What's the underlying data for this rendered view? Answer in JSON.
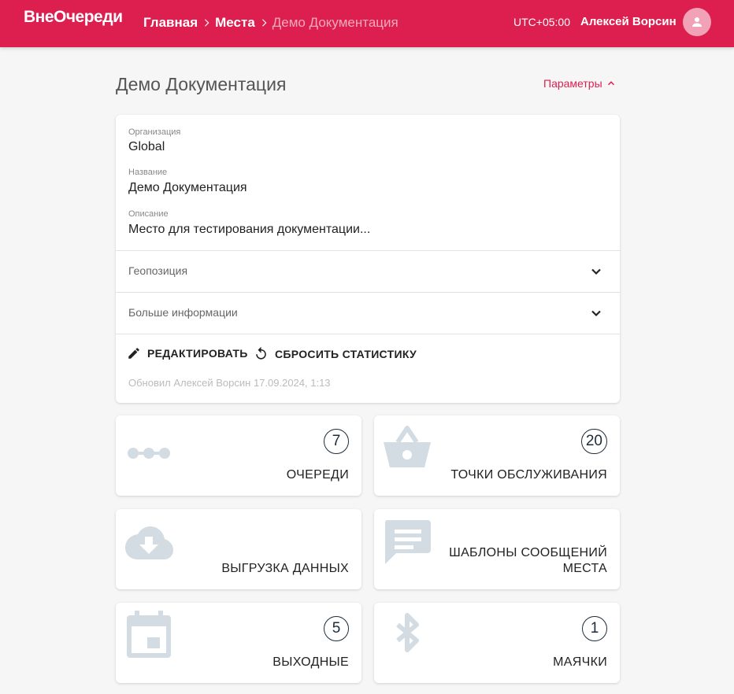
{
  "header": {
    "logo": "ВнеОчереди",
    "breadcrumbs": [
      "Главная",
      "Места",
      "Демо Документация"
    ],
    "timezone": "UTC+05:00",
    "user_name": "Алексей Ворсин"
  },
  "page": {
    "title": "Демо Документация",
    "params_label": "Параметры"
  },
  "info": {
    "org_label": "Организация",
    "org_value": "Global",
    "name_label": "Название",
    "name_value": "Демо Документация",
    "desc_label": "Описание",
    "desc_value": "Место для тестирования документации...",
    "geo_label": "Геопозиция",
    "more_label": "Больше информации",
    "edit_label": "РЕДАКТИРОВАТЬ",
    "reset_label": "СБРОСИТЬ СТАТИСТИКУ",
    "updated": "Обновил Алексей Ворсин 17.09.2024, 1:13"
  },
  "tiles": [
    {
      "label": "ОЧЕРЕДИ",
      "count": "7",
      "icon": "queue-icon"
    },
    {
      "label": "ТОЧКИ ОБСЛУЖИВАНИЯ",
      "count": "20",
      "icon": "basket-icon"
    },
    {
      "label_line1": "ВЫГРУЗКА ДАННЫХ",
      "icon": "cloud-download-icon"
    },
    {
      "label_line1": "ШАБЛОНЫ СООБЩЕНИЙ",
      "label_line2": "МЕСТА",
      "icon": "message-icon"
    },
    {
      "label": "ВЫХОДНЫЕ",
      "count": "5",
      "icon": "calendar-icon"
    },
    {
      "label": "МАЯЧКИ",
      "count": "1",
      "icon": "bluetooth-icon"
    }
  ],
  "colors": {
    "brand": "#dc1f4f",
    "icon_muted": "#d3dce2",
    "count_border": "#1c2b3a"
  }
}
